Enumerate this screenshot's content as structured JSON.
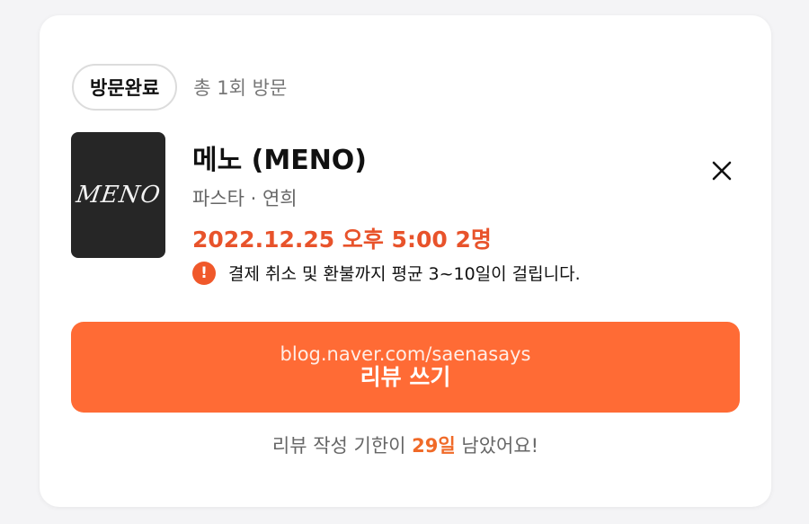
{
  "status": {
    "chip_label": "방문완료",
    "visit_count": "총 1회 방문"
  },
  "shop": {
    "thumbnail_text": "MENO",
    "name": "메노 (MENO)",
    "category": "파스타 · 연희",
    "reservation": "2022.12.25 오후 5:00 2명"
  },
  "notice": {
    "icon": "info-icon",
    "text": "결제 취소 및 환불까지 평균 3~10일이 걸립니다."
  },
  "review_button": {
    "watermark": "blog.naver.com/saenasays",
    "label": "리뷰 쓰기"
  },
  "deadline": {
    "prefix": "리뷰 작성 기한이 ",
    "days": "29일",
    "suffix": " 남았어요!"
  },
  "colors": {
    "accent": "#ff6b35",
    "reservation_text": "#e8532b",
    "days_text": "#f06a28"
  }
}
